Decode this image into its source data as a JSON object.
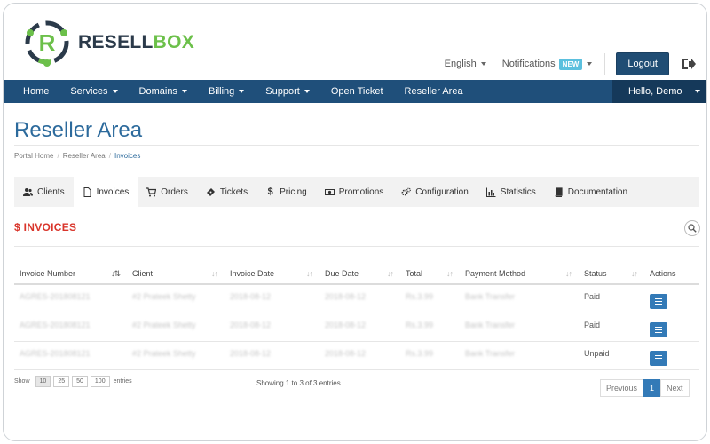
{
  "brand": {
    "name_part1": "RESELL",
    "name_part2": "BOX",
    "logo_letter": "R",
    "colors": {
      "dark": "#2b3a4a",
      "green": "#6cc04a",
      "blue": "#1f4f7a"
    }
  },
  "header": {
    "language": "English",
    "notifications": "Notifications",
    "new_badge": "NEW",
    "logout": "Logout",
    "exit_icon": "sign-out-icon"
  },
  "nav": {
    "items": [
      {
        "label": "Home",
        "dropdown": false
      },
      {
        "label": "Services",
        "dropdown": true
      },
      {
        "label": "Domains",
        "dropdown": true
      },
      {
        "label": "Billing",
        "dropdown": true
      },
      {
        "label": "Support",
        "dropdown": true
      },
      {
        "label": "Open Ticket",
        "dropdown": false
      },
      {
        "label": "Reseller Area",
        "dropdown": false
      }
    ],
    "user_menu": "Hello, Demo"
  },
  "page": {
    "title": "Reseller Area",
    "breadcrumb": [
      "Portal Home",
      "Reseller Area",
      "Invoices"
    ]
  },
  "tabs": [
    {
      "label": "Clients",
      "icon": "users-icon",
      "active": false
    },
    {
      "label": "Invoices",
      "icon": "file-icon",
      "active": true
    },
    {
      "label": "Orders",
      "icon": "cart-icon",
      "active": false
    },
    {
      "label": "Tickets",
      "icon": "ticket-icon",
      "active": false
    },
    {
      "label": "Pricing",
      "icon": "dollar-icon",
      "active": false
    },
    {
      "label": "Promotions",
      "icon": "money-icon",
      "active": false
    },
    {
      "label": "Configuration",
      "icon": "cogs-icon",
      "active": false
    },
    {
      "label": "Statistics",
      "icon": "bar-chart-icon",
      "active": false
    },
    {
      "label": "Documentation",
      "icon": "book-icon",
      "active": false
    }
  ],
  "section": {
    "title": "$ INVOICES",
    "search_icon": "search-icon"
  },
  "table": {
    "columns": [
      "Invoice Number",
      "Client",
      "Invoice Date",
      "Due Date",
      "Total",
      "Payment Method",
      "Status",
      "Actions"
    ],
    "rows": [
      {
        "invoice": "AGRES-201808121",
        "client": "#2 Prateek Shetty",
        "invoice_date": "2018-08-12",
        "due_date": "2018-08-12",
        "total": "Rs.3.99",
        "method": "Bank Transfer",
        "status": "Paid"
      },
      {
        "invoice": "AGRES-201808121",
        "client": "#2 Prateek Shetty",
        "invoice_date": "2018-08-12",
        "due_date": "2018-08-12",
        "total": "Rs.3.99",
        "method": "Bank Transfer",
        "status": "Paid"
      },
      {
        "invoice": "AGRES-201808121",
        "client": "#2 Prateek Shetty",
        "invoice_date": "2018-08-12",
        "due_date": "2018-08-12",
        "total": "Rs.3.99",
        "method": "Bank Transfer",
        "status": "Unpaid"
      }
    ]
  },
  "footer": {
    "show_label": "Show",
    "page_lengths": [
      "10",
      "25",
      "50",
      "100"
    ],
    "selected_length": "10",
    "entries_label": "entries",
    "info": "Showing 1 to 3 of 3 entries",
    "previous": "Previous",
    "current_page": "1",
    "next": "Next"
  }
}
